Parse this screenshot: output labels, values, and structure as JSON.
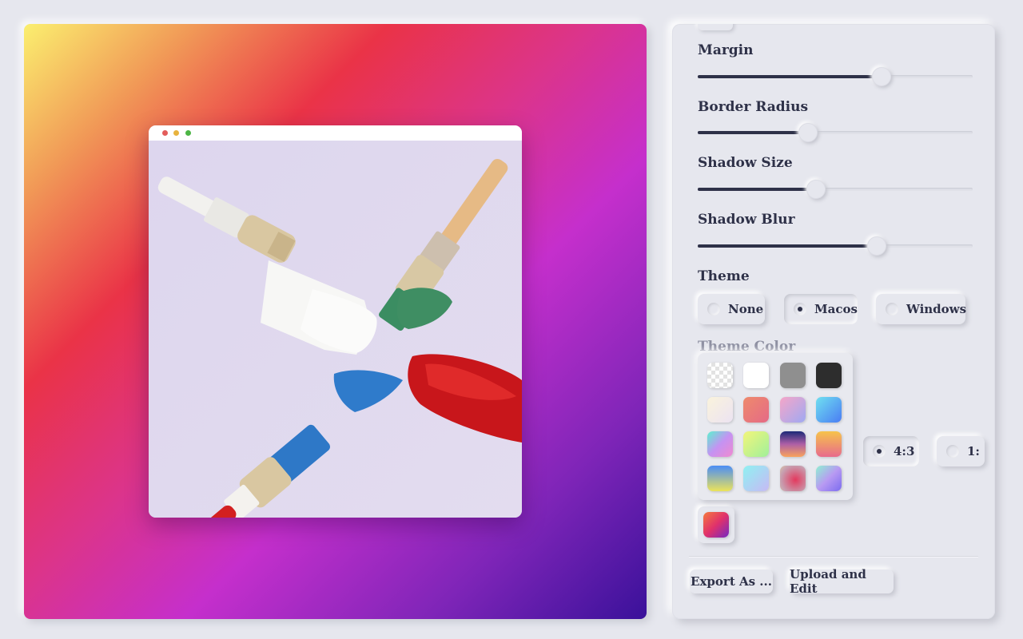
{
  "controls": {
    "margin": {
      "label": "Margin",
      "value": 0.67
    },
    "border_radius": {
      "label": "Border Radius",
      "value": 0.4
    },
    "shadow_size": {
      "label": "Shadow Size",
      "value": 0.43
    },
    "shadow_blur": {
      "label": "Shadow Blur",
      "value": 0.65
    }
  },
  "theme": {
    "label": "Theme",
    "options": [
      "None",
      "Macos",
      "Windows"
    ],
    "selected": "Macos",
    "window_dots": [
      "#e35d5b",
      "#e8b33f",
      "#4cb545"
    ]
  },
  "theme_color": {
    "label": "Theme Color"
  },
  "aspect_ratio": {
    "options": [
      "4:3",
      "1:"
    ],
    "selected": "4:3"
  },
  "palette": {
    "swatches": [
      "transparent-checker",
      "#ffffff",
      "#8f8f8f",
      "#2d2d2d",
      "cream",
      "coral",
      "lavender-pink",
      "sky-blue",
      "aqua-pink",
      "lime",
      "sunset-navy",
      "peach-orange",
      "blue-yellow",
      "cyan-lilac",
      "rose-radial",
      "mint-violet"
    ],
    "selected": "orange-purple"
  },
  "actions": {
    "export_label": "Export As ...",
    "upload_label": "Upload and Edit"
  }
}
